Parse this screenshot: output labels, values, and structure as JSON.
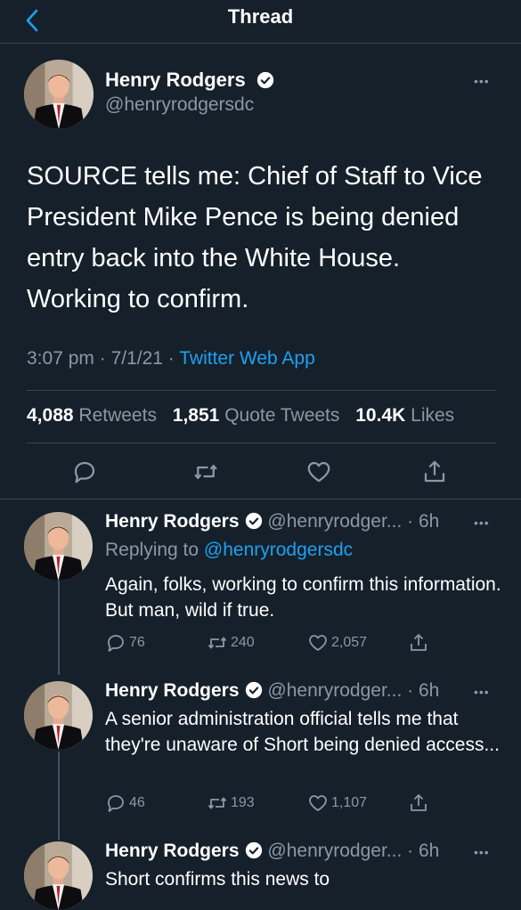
{
  "header": {
    "title": "Thread"
  },
  "main_tweet": {
    "name": "Henry Rodgers",
    "handle": "@henryrodgersdc",
    "text": "SOURCE tells me: Chief of Staff to Vice President Mike Pence is being denied entry back into the White House. Working to confirm.",
    "time": "3:07 pm",
    "date": "7/1/21",
    "source": "Twitter Web App",
    "stats": {
      "retweets_count": "4,088",
      "retweets_label": "Retweets",
      "quotes_count": "1,851",
      "quotes_label": "Quote Tweets",
      "likes_count": "10.4K",
      "likes_label": "Likes"
    },
    "more": "•••"
  },
  "replies": [
    {
      "name": "Henry Rodgers",
      "handle": "@henryrodger...",
      "age": "· 6h",
      "replying_to_label": "Replying to",
      "replying_to": "@henryrodgersdc",
      "text": "Again, folks, working to confirm this information. But man, wild if true.",
      "replies": "76",
      "retweets": "240",
      "likes": "2,057"
    },
    {
      "name": "Henry Rodgers",
      "handle": "@henryrodger...",
      "age": "· 6h",
      "text": "A senior administration official tells me that they're unaware of Short being denied access...",
      "replies": "46",
      "retweets": "193",
      "likes": "1,107"
    },
    {
      "name": "Henry Rodgers",
      "handle": "@henryrodger...",
      "age": "· 6h",
      "text": "Short confirms this news to"
    }
  ],
  "colors": {
    "background": "#15202b",
    "accent": "#1da1f2",
    "secondary": "#8899a6",
    "divider": "#38444d"
  },
  "icons": [
    "chevron-left-icon",
    "verified-badge-icon",
    "reply-icon",
    "retweet-icon",
    "like-icon",
    "share-icon",
    "more-icon"
  ]
}
